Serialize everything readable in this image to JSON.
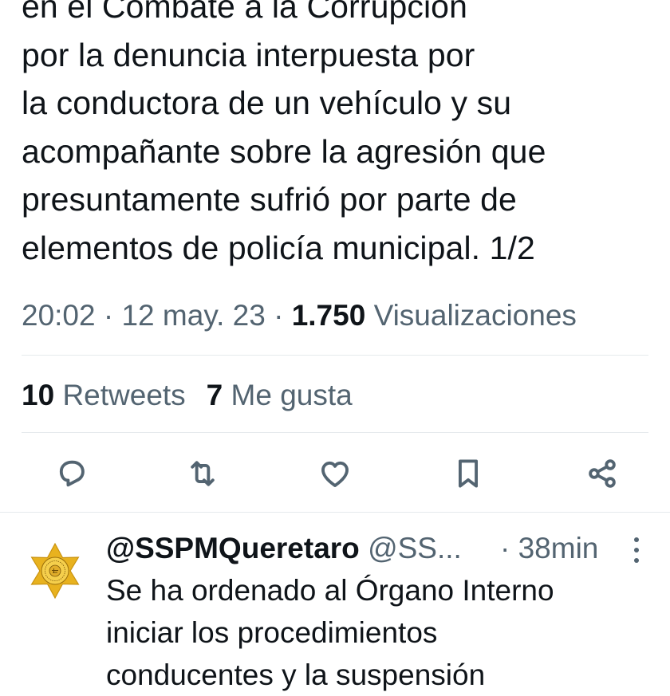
{
  "tweet": {
    "text_lines": [
      "en el Combate a la Corrupción",
      "por la denuncia interpuesta por",
      "la conductora de un vehículo y su",
      "acompañante sobre la agresión que",
      "presuntamente sufrió por parte de",
      "elementos de policía municipal. 1/2"
    ],
    "time": "20:02",
    "separator": "·",
    "date": "12 may. 23",
    "views_count": "1.750",
    "views_label": "Visualizaciones",
    "retweets_count": "10",
    "retweets_label": "Retweets",
    "likes_count": "7",
    "likes_label": "Me gusta"
  },
  "actions": [
    {
      "icon": "reply-icon"
    },
    {
      "icon": "retweet-icon"
    },
    {
      "icon": "like-heart-icon"
    },
    {
      "icon": "bookmark-icon"
    },
    {
      "icon": "share-icon"
    }
  ],
  "reply": {
    "display_name": "@SSPMQueretaro",
    "handle": "@SS...",
    "separator": "·",
    "time_ago": "38min",
    "text_lines": [
      "Se ha ordenado al Órgano Interno",
      "iniciar los procedimientos",
      "conducentes y la suspensión"
    ],
    "avatar_icon": "police-star-badge-icon"
  },
  "colors": {
    "text_primary": "#0f1419",
    "text_secondary": "#536471",
    "divider": "#e6eaed",
    "badge_gold": "#e8b21f"
  }
}
